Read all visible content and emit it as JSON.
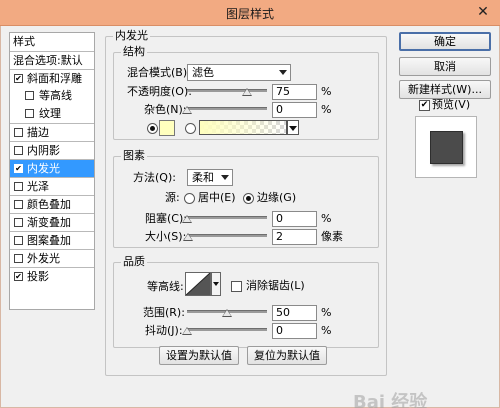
{
  "window": {
    "title": "图层样式",
    "close_glyph": "✕"
  },
  "left_list": {
    "items": [
      {
        "label": "样式",
        "type": "header"
      },
      {
        "label": "混合选项:默认",
        "type": "header"
      },
      {
        "label": "斜面和浮雕",
        "checked": true
      },
      {
        "label": "等高线",
        "checked": false,
        "indent": true
      },
      {
        "label": "纹理",
        "checked": false,
        "indent": true
      },
      {
        "label": "描边",
        "checked": false
      },
      {
        "label": "内阴影",
        "checked": false
      },
      {
        "label": "内发光",
        "checked": true,
        "selected": true
      },
      {
        "label": "光泽",
        "checked": false
      },
      {
        "label": "颜色叠加",
        "checked": false
      },
      {
        "label": "渐变叠加",
        "checked": false
      },
      {
        "label": "图案叠加",
        "checked": false
      },
      {
        "label": "外发光",
        "checked": false
      },
      {
        "label": "投影",
        "checked": true
      }
    ]
  },
  "panel": {
    "title": "内发光",
    "structure": {
      "title": "结构",
      "blend_mode_label": "混合模式(B):",
      "blend_mode_value": "滤色",
      "opacity_label": "不透明度(O):",
      "opacity_value": "75",
      "opacity_level": 0.75,
      "noise_label": "杂色(N):",
      "noise_value": "0",
      "noise_level": 0,
      "percent": "%",
      "swatch_color": "#ffffbe"
    },
    "elements": {
      "title": "图素",
      "method_label": "方法(Q):",
      "method_value": "柔和",
      "source_label": "源:",
      "source_center": "居中(E)",
      "source_edge": "边缘(G)",
      "choke_label": "阻塞(C):",
      "choke_value": "0",
      "choke_level": 0,
      "size_label": "大小(S):",
      "size_value": "2",
      "size_level": 0.01,
      "size_unit": "像素",
      "percent": "%"
    },
    "quality": {
      "title": "品质",
      "contour_label": "等高线:",
      "antialias_label": "消除锯齿(L)",
      "range_label": "范围(R):",
      "range_value": "50",
      "range_level": 0.5,
      "jitter_label": "抖动(J):",
      "jitter_value": "0",
      "jitter_level": 0,
      "percent": "%"
    },
    "buttons": {
      "set_default": "设置为默认值",
      "reset_default": "复位为默认值"
    }
  },
  "right": {
    "ok": "确定",
    "cancel": "取消",
    "new_style": "新建样式(W)...",
    "preview_label": "预览(V)",
    "preview_checked": true
  },
  "watermark": "Bai 经验"
}
